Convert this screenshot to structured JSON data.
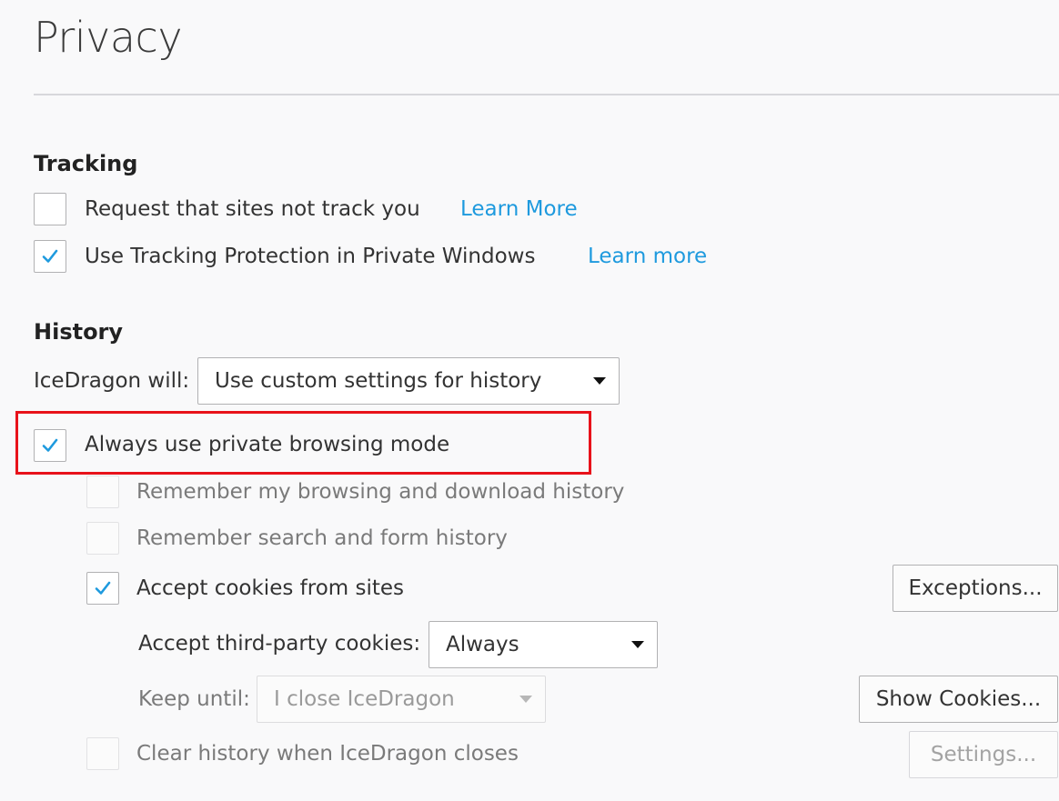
{
  "page": {
    "title": "Privacy"
  },
  "tracking": {
    "heading": "Tracking",
    "do_not_track": {
      "label": "Request that sites not track you",
      "checked": false,
      "link": "Learn More"
    },
    "tracking_protection": {
      "label": "Use Tracking Protection in Private Windows",
      "checked": true,
      "link": "Learn more"
    }
  },
  "history": {
    "heading": "History",
    "mode_label": "IceDragon will:",
    "mode_value": "Use custom settings for history",
    "always_private": {
      "label": "Always use private browsing mode",
      "checked": true
    },
    "remember_browsing": {
      "label": "Remember my browsing and download history",
      "checked": false
    },
    "remember_search": {
      "label": "Remember search and form history",
      "checked": false
    },
    "accept_cookies": {
      "label": "Accept cookies from sites",
      "checked": true
    },
    "exceptions_button": "Exceptions...",
    "third_party_label": "Accept third-party cookies:",
    "third_party_value": "Always",
    "keep_until_label": "Keep until:",
    "keep_until_value": "I close IceDragon",
    "show_cookies_button": "Show Cookies...",
    "clear_history": {
      "label": "Clear history when IceDragon closes",
      "checked": false
    },
    "settings_button": "Settings..."
  },
  "colors": {
    "link": "#1e9ade",
    "highlight": "#e8121a",
    "check": "#1e9ade"
  }
}
